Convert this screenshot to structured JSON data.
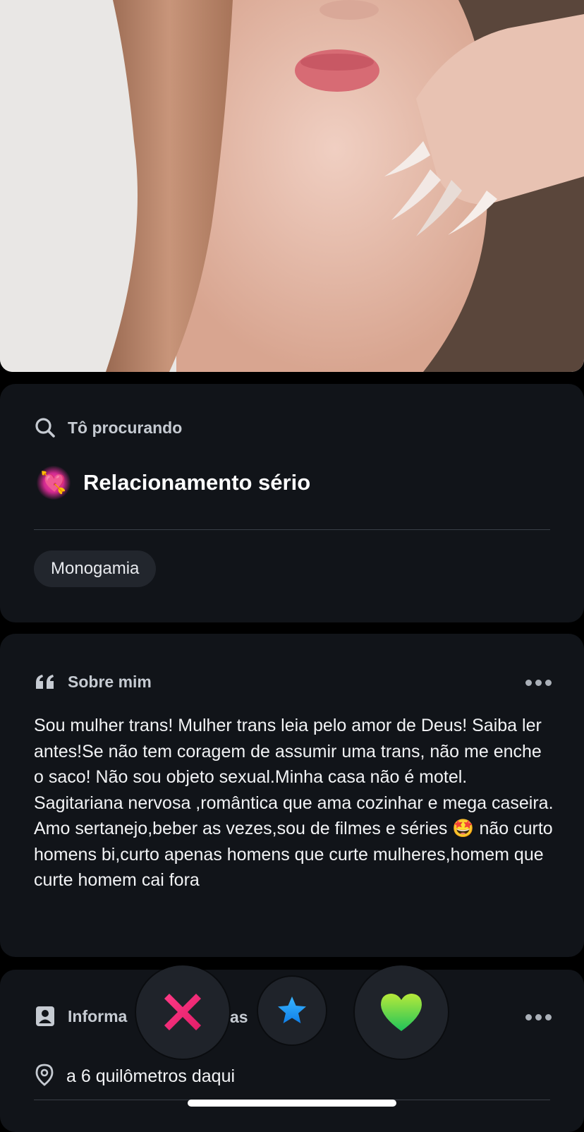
{
  "looking_for": {
    "heading": "Tô procurando",
    "emoji": "💘",
    "value": "Relacionamento sério",
    "chip": "Monogamia"
  },
  "about": {
    "heading": "Sobre mim",
    "bio_before_emoji": "Sou mulher trans! Mulher trans leia pelo amor de Deus! Saiba ler antes!Se não tem coragem de assumir uma trans, não me enche o saco! Não sou objeto sexual.Minha casa não é motel. Sagitariana nervosa ,romântica que ama cozinhar e mega caseira. Amo sertanejo,beber as vezes,sou de filmes e séries",
    "bio_emoji": "🤩",
    "bio_after_emoji": " não curto homens bi,curto apenas homens que curte mulheres,homem que curte homem cai fora"
  },
  "info": {
    "heading_left": "Informa",
    "heading_right": "as",
    "location": "a 6 quilômetros daqui"
  },
  "actions": {
    "nope": "✖",
    "super_like": "★",
    "like": "♥"
  },
  "colors": {
    "card_bg": "#111419",
    "nope": "#ff2d7a",
    "super_like": "#1e9bff",
    "like": "#3fd14e"
  },
  "icons": {
    "looking_for": "search-icon",
    "about": "quote-icon",
    "info": "id-card-icon",
    "location": "location-pin-icon",
    "more": "more-dots-icon"
  }
}
